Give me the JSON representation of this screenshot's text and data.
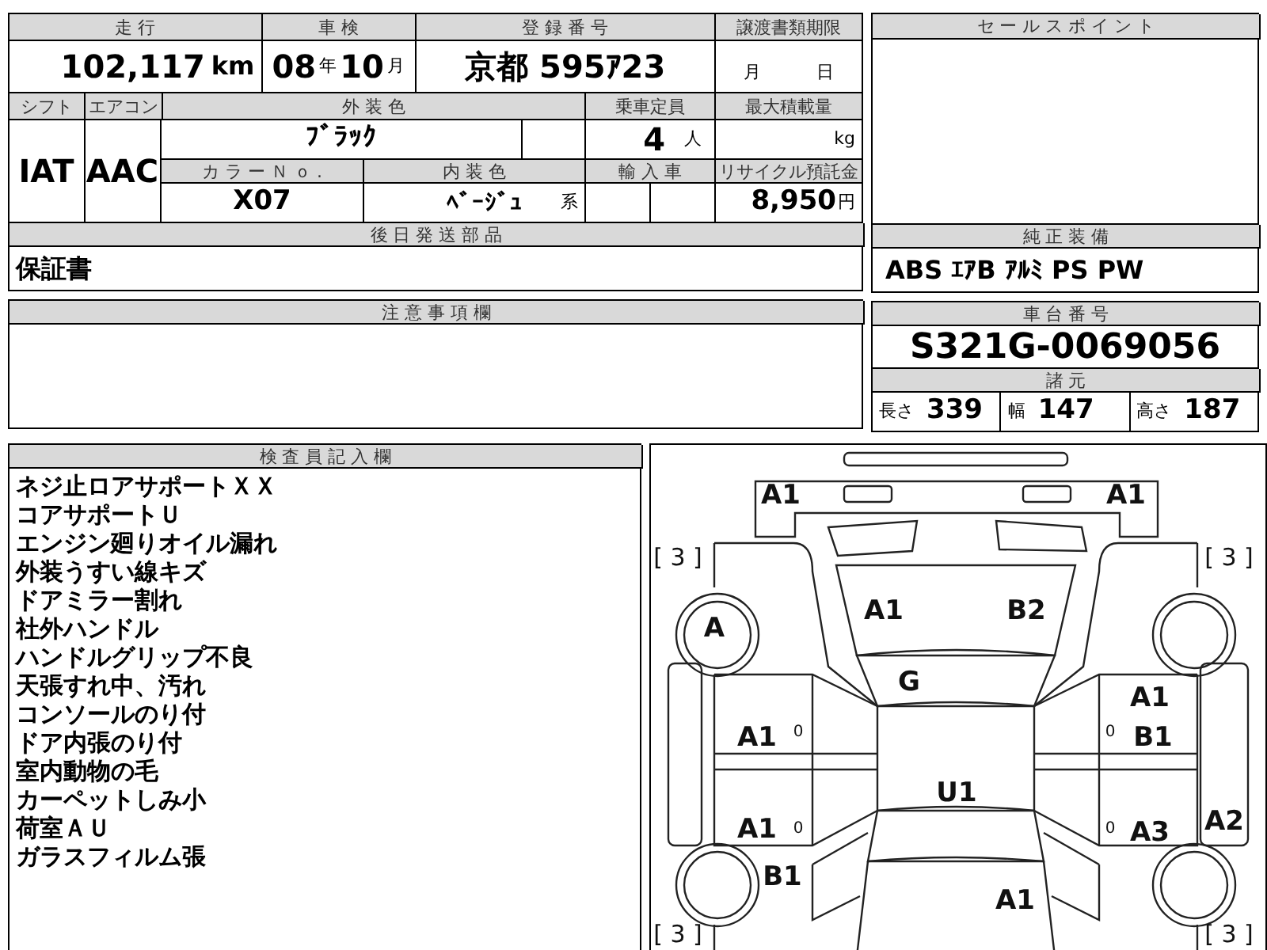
{
  "mileage": {
    "label": "走 行",
    "value": "102,117",
    "unit": "km"
  },
  "inspection": {
    "label": "車 検",
    "year": "08",
    "year_unit": "年",
    "month": "10",
    "month_unit": "月"
  },
  "registration": {
    "label": "登 録 番 号",
    "value": "京都 595ｱ23"
  },
  "transfer_deadline": {
    "label": "譲渡書類期限",
    "month_unit": "月",
    "day_unit": "日"
  },
  "shift": {
    "label": "シフト",
    "value": "IAT"
  },
  "aircon": {
    "label": "エアコン",
    "value": "AAC"
  },
  "exterior_color": {
    "label": "外 装 色",
    "value": "ﾌﾞﾗｯｸ"
  },
  "capacity": {
    "label": "乗車定員",
    "value": "4",
    "unit": "人"
  },
  "max_load": {
    "label": "最大積載量",
    "unit": "kg"
  },
  "color_no": {
    "label": "カ ラ ー Ｎ ｏ .",
    "value": "X07"
  },
  "interior_color": {
    "label": "内 装 色",
    "value": "ﾍﾞｰｼﾞｭ",
    "suffix": "系"
  },
  "import": {
    "label": "輸 入 車"
  },
  "recycle_fee": {
    "label": "リサイクル預託金",
    "value": "8,950",
    "unit": "円"
  },
  "later_parts": {
    "label": "後 日 発 送 部 品",
    "value": "保証書"
  },
  "notes": {
    "label": "注 意 事 項 欄"
  },
  "sales_points": {
    "label": "セ ー ル ス ポ イ ン ト"
  },
  "equipment": {
    "label": "純 正 装 備",
    "value": "ABS ｴｱB ｱﾙﾐ PS PW"
  },
  "chassis": {
    "label": "車 台 番 号",
    "value": "S321G-0069056"
  },
  "specs": {
    "label": "諸 元",
    "items": [
      {
        "label": "長さ",
        "value": "339"
      },
      {
        "label": "幅",
        "value": "147"
      },
      {
        "label": "高さ",
        "value": "187"
      }
    ]
  },
  "inspector_notes": {
    "label": "検 査 員 記 入 欄",
    "lines": [
      "ネジ止ロアサポートＸＸ",
      "コアサポートＵ",
      "エンジン廻りオイル漏れ",
      "外装うすい線キズ",
      "ドアミラー割れ",
      "社外ハンドル",
      "ハンドルグリップ不良",
      "天張すれ中、汚れ",
      "コンソールのり付",
      "ドア内張のり付",
      "室内動物の毛",
      "カーペットしみ小",
      "荷室ＡＵ",
      "ガラスフィルム張"
    ]
  },
  "diagram": {
    "labels": [
      {
        "text": "A1",
        "kind": "code"
      },
      {
        "text": "A1",
        "kind": "code"
      },
      {
        "text": "[ 3 ]",
        "kind": "tire"
      },
      {
        "text": "[ 3 ]",
        "kind": "tire"
      },
      {
        "text": "A",
        "kind": "code"
      },
      {
        "text": "A1",
        "kind": "code"
      },
      {
        "text": "B2",
        "kind": "code"
      },
      {
        "text": "G",
        "kind": "code"
      },
      {
        "text": "A1",
        "kind": "code"
      },
      {
        "text": "A1",
        "kind": "code"
      },
      {
        "text": "B1",
        "kind": "code"
      },
      {
        "text": "U1",
        "kind": "code"
      },
      {
        "text": "A1",
        "kind": "code"
      },
      {
        "text": "A3",
        "kind": "code"
      },
      {
        "text": "A2",
        "kind": "code"
      },
      {
        "text": "B1",
        "kind": "code"
      },
      {
        "text": "A1",
        "kind": "code"
      },
      {
        "text": "[ 3 ]",
        "kind": "tire"
      },
      {
        "text": "[ 3 ]",
        "kind": "tire"
      },
      {
        "text": "0",
        "kind": "small"
      },
      {
        "text": "0",
        "kind": "small"
      },
      {
        "text": "0",
        "kind": "small"
      },
      {
        "text": "0",
        "kind": "small"
      }
    ]
  }
}
